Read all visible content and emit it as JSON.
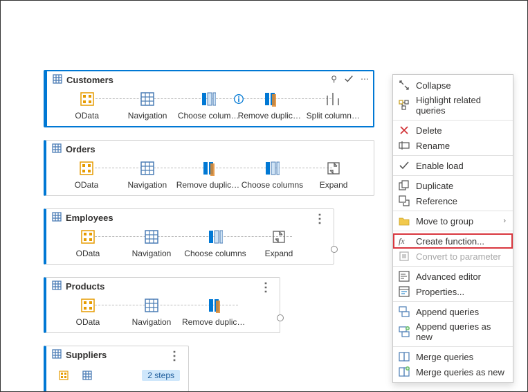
{
  "queries": [
    {
      "name": "Customers",
      "selected": true,
      "steps": [
        {
          "label": "OData",
          "icon": "odata"
        },
        {
          "label": "Navigation",
          "icon": "grid"
        },
        {
          "label": "Choose colum…",
          "icon": "choose-cols",
          "info": true
        },
        {
          "label": "Remove duplicat…",
          "icon": "remove-dup"
        },
        {
          "label": "Split column…",
          "icon": "split-col"
        }
      ]
    },
    {
      "name": "Orders",
      "steps": [
        {
          "label": "OData",
          "icon": "odata"
        },
        {
          "label": "Navigation",
          "icon": "grid"
        },
        {
          "label": "Remove duplicat…",
          "icon": "remove-dup"
        },
        {
          "label": "Choose columns",
          "icon": "choose-cols"
        },
        {
          "label": "Expand",
          "icon": "expand"
        }
      ]
    },
    {
      "name": "Employees",
      "more": true,
      "out": true,
      "steps": [
        {
          "label": "OData",
          "icon": "odata"
        },
        {
          "label": "Navigation",
          "icon": "grid"
        },
        {
          "label": "Choose columns",
          "icon": "choose-cols"
        },
        {
          "label": "Expand",
          "icon": "expand"
        }
      ]
    },
    {
      "name": "Products",
      "more": true,
      "out": true,
      "steps": [
        {
          "label": "OData",
          "icon": "odata"
        },
        {
          "label": "Navigation",
          "icon": "grid"
        },
        {
          "label": "Remove duplicat…",
          "icon": "remove-dup"
        }
      ]
    },
    {
      "name": "Suppliers",
      "more": true,
      "out": true,
      "collapsed": true,
      "steps_badge": "2 steps"
    }
  ],
  "context_menu": [
    {
      "label": "Collapse",
      "icon": "collapse"
    },
    {
      "label": "Highlight related queries",
      "icon": "highlight"
    },
    {
      "sep": true
    },
    {
      "label": "Delete",
      "icon": "delete"
    },
    {
      "label": "Rename",
      "icon": "rename"
    },
    {
      "sep": true
    },
    {
      "label": "Enable load",
      "icon": "check"
    },
    {
      "sep": true
    },
    {
      "label": "Duplicate",
      "icon": "duplicate"
    },
    {
      "label": "Reference",
      "icon": "reference"
    },
    {
      "sep": true
    },
    {
      "label": "Move to group",
      "icon": "folder",
      "submenu": true
    },
    {
      "sep": true
    },
    {
      "label": "Create function...",
      "icon": "fx",
      "highlight": true
    },
    {
      "label": "Convert to parameter",
      "icon": "param",
      "disabled": true
    },
    {
      "sep": true
    },
    {
      "label": "Advanced editor",
      "icon": "adv-editor"
    },
    {
      "label": "Properties...",
      "icon": "properties"
    },
    {
      "sep": true
    },
    {
      "label": "Append queries",
      "icon": "append"
    },
    {
      "label": "Append queries as new",
      "icon": "append-new"
    },
    {
      "sep": true
    },
    {
      "label": "Merge queries",
      "icon": "merge"
    },
    {
      "label": "Merge queries as new",
      "icon": "merge-new"
    }
  ]
}
